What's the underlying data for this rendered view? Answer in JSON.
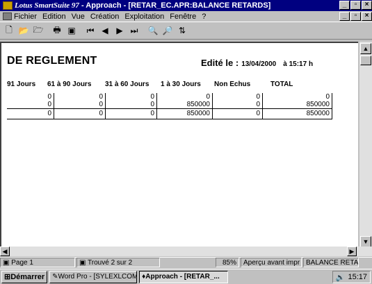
{
  "window": {
    "brand": "Lotus SmartSuite 97",
    "title_rest": " - Approach - [RETAR_EC.APR:BALANCE RETARDS]"
  },
  "menu": [
    "Fichier",
    "Edition",
    "Vue",
    "Création",
    "Exploitation",
    "Fenêtre",
    "?"
  ],
  "report": {
    "title": "DE REGLEMENT",
    "edited_label": "Edité le :",
    "edited_date": "13/04/2000",
    "edited_time": "à 15:17 h",
    "columns": [
      "91 Jours",
      "61 à 90 Jours",
      "31 à 60 Jours",
      "1 à 30 Jours",
      "Non Echus",
      "TOTAL"
    ],
    "detail_rows": [
      [
        "0",
        "0",
        "0",
        "0",
        "0",
        "0"
      ],
      [
        "0",
        "0",
        "0",
        "850000",
        "0",
        "850000"
      ]
    ],
    "total_row": [
      "0",
      "0",
      "0",
      "850000",
      "0",
      "850000"
    ]
  },
  "status": {
    "page": "Page 1",
    "found": "Trouvé 2 sur 2",
    "zoom": "85%",
    "mode": "Aperçu avant impr",
    "view": "BALANCE RETARDS"
  },
  "taskbar": {
    "start": "Démarrer",
    "tasks": [
      "Word Pro - [SYLEXLCOM...",
      "Approach - [RETAR_..."
    ],
    "clock": "15:17"
  }
}
